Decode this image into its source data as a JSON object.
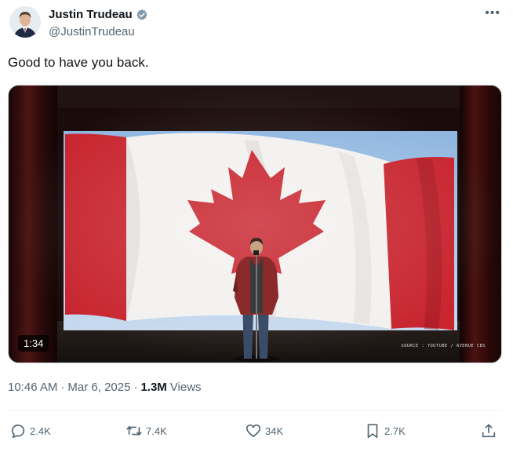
{
  "author": {
    "display_name": "Justin Trudeau",
    "handle": "@JustinTrudeau",
    "verified": true
  },
  "tweet": {
    "text": "Good to have you back."
  },
  "media": {
    "duration": "1:34",
    "source_caption": "SOURCE : YOUTUBE / AVENUE CBS"
  },
  "meta": {
    "time": "10:46 AM",
    "date": "Mar 6, 2025",
    "separator": "·",
    "views_count": "1.3M",
    "views_label": "Views"
  },
  "actions": {
    "replies": "2.4K",
    "reposts": "7.4K",
    "likes": "34K",
    "bookmarks": "2.7K"
  },
  "colors": {
    "text_primary": "#0f1419",
    "text_secondary": "#536471",
    "verified_badge": "#829aab",
    "flag_red": "#c8252f"
  }
}
